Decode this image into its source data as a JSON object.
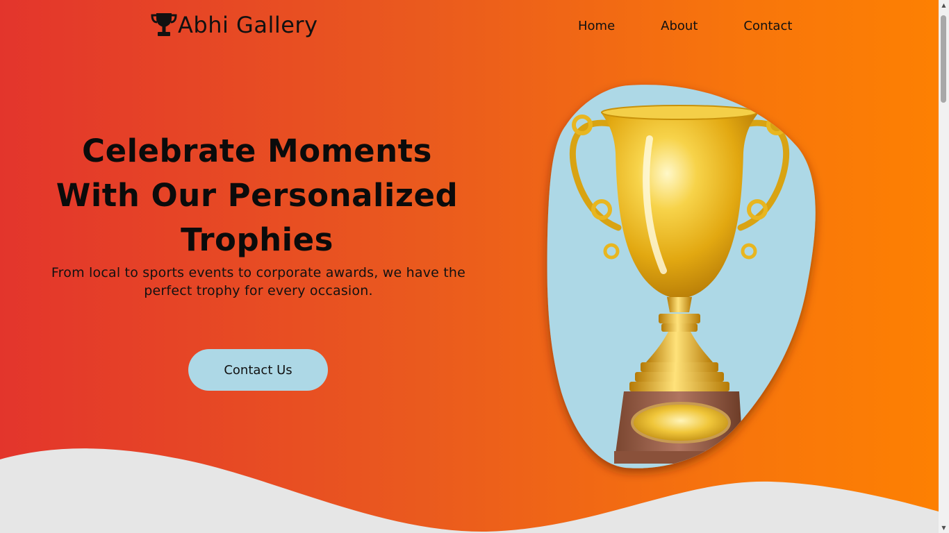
{
  "brand": {
    "title": "Abhi Gallery",
    "icon": "trophy-icon"
  },
  "nav": {
    "items": [
      "Home",
      "About",
      "Contact"
    ]
  },
  "hero": {
    "headline": "Celebrate Moments With Our Personalized Trophies",
    "subtext": "From local to sports events to corporate awards, we have the perfect trophy for every occasion.",
    "cta_label": "Contact Us",
    "image": "gold-trophy-illustration"
  },
  "colors": {
    "gradient_start": "#e3352c",
    "gradient_end": "#fd8002",
    "button": "#add8e6",
    "blob_background": "#add8e6",
    "wave": "#e6e6e6"
  }
}
